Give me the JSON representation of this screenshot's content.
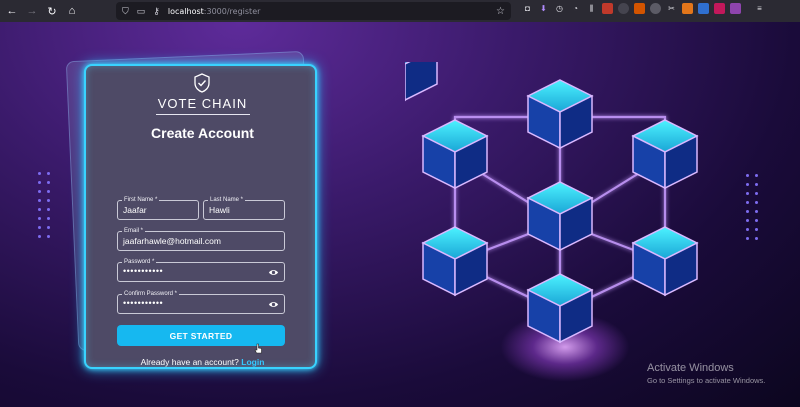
{
  "browser": {
    "url_host": "localhost",
    "url_path": ":3000/register",
    "nav": {
      "back": "←",
      "forward": "→",
      "reload": "↻",
      "home": "⌂"
    }
  },
  "app": {
    "brand": "VOTE CHAIN",
    "title": "Create Account",
    "fields": {
      "first_name": {
        "label": "First Name *",
        "value": "Jaafar"
      },
      "last_name": {
        "label": "Last Name *",
        "value": "Hawli"
      },
      "email": {
        "label": "Email *",
        "value": "jaafarhawle@hotmail.com"
      },
      "password": {
        "label": "Password *",
        "value": "•••••••••••"
      },
      "confirm_password": {
        "label": "Confirm Password *",
        "value": "•••••••••••"
      }
    },
    "submit_label": "GET STARTED",
    "footer_text": "Already have an account?",
    "login_link": "Login"
  },
  "os": {
    "activate_title": "Activate Windows",
    "activate_sub": "Go to Settings to activate Windows."
  },
  "colors": {
    "accent": "#16b8f0",
    "card": "#4e4a66",
    "glow": "#39d3ff",
    "link": "#33c8ff"
  }
}
